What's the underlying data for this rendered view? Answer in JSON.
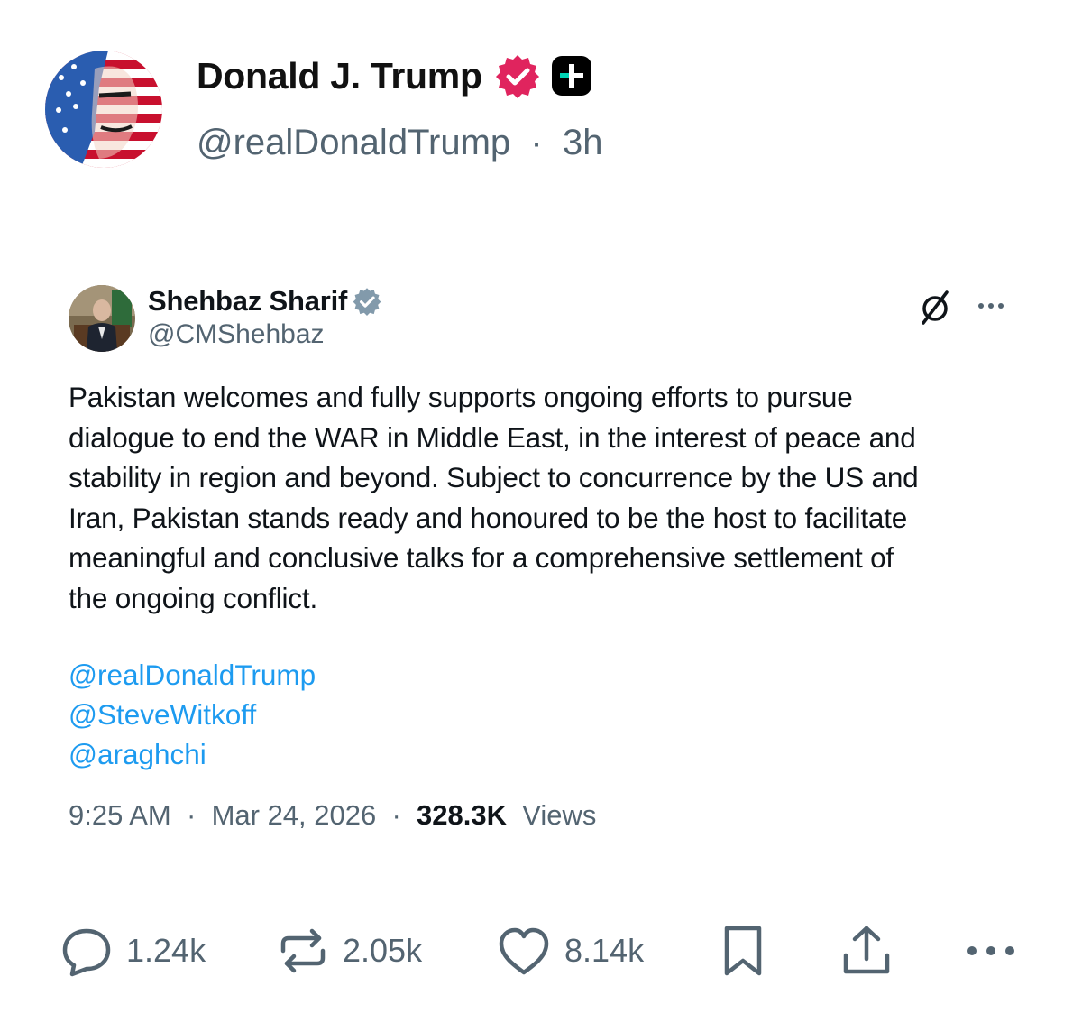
{
  "post": {
    "author_name": "Donald J. Trump",
    "author_handle": "@realDonaldTrump",
    "separator": "·",
    "time_ago": "3h",
    "verified_color": "#e0245e",
    "plus_badge_color": "#000000",
    "plus_accent_color": "#00d4b4"
  },
  "embed": {
    "author_name": "Shehbaz Sharif",
    "author_handle": "@CMShehbaz",
    "verified_color": "#829aab",
    "body": "Pakistan welcomes and fully supports ongoing efforts to pursue\ndialogue to end the WAR in Middle East, in the interest of peace and\nstability in region and beyond. Subject to concurrence by the US and\nIran, Pakistan stands ready and honoured to be the host to facilitate\nmeaningful and conclusive talks for a comprehensive settlement of\nthe ongoing conflict.",
    "mentions": [
      "@realDonaldTrump",
      "@SteveWitkoff",
      "@araghchi"
    ],
    "time": "9:25 AM",
    "date": "Mar 24, 2026",
    "separator": "·",
    "views_count": "328.3K",
    "views_label": "Views",
    "icons": [
      "grok-icon",
      "more-icon"
    ]
  },
  "actions": {
    "replies": "1.24k",
    "reposts": "2.05k",
    "likes": "8.14k",
    "icons": [
      "reply-icon",
      "repost-icon",
      "like-icon",
      "bookmark-icon",
      "share-icon",
      "more-icon"
    ]
  }
}
